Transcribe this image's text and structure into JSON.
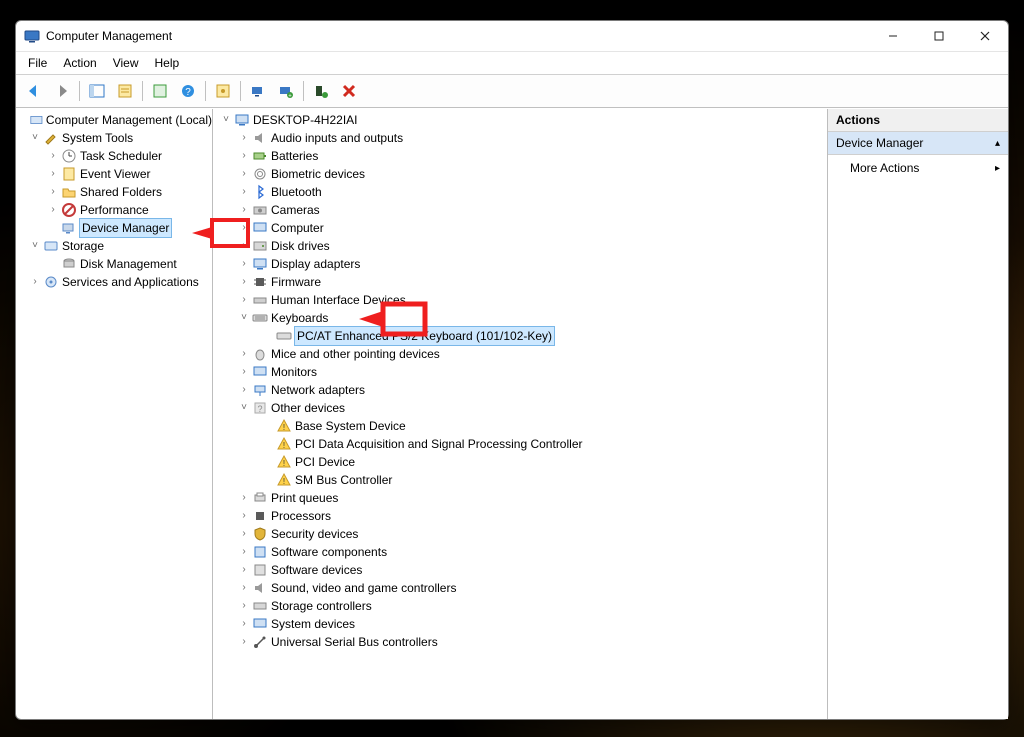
{
  "window": {
    "title": "Computer Management"
  },
  "menu": {
    "file": "File",
    "action": "Action",
    "view": "View",
    "help": "Help"
  },
  "left_tree": {
    "root": "Computer Management (Local)",
    "system_tools": "System Tools",
    "task_scheduler": "Task Scheduler",
    "event_viewer": "Event Viewer",
    "shared_folders": "Shared Folders",
    "performance": "Performance",
    "device_manager": "Device Manager",
    "storage": "Storage",
    "disk_management": "Disk Management",
    "services_apps": "Services and Applications"
  },
  "device_tree": {
    "host": "DESKTOP-4H22IAI",
    "audio": "Audio inputs and outputs",
    "batteries": "Batteries",
    "biometric": "Biometric devices",
    "bluetooth": "Bluetooth",
    "cameras": "Cameras",
    "computer": "Computer",
    "disk": "Disk drives",
    "display": "Display adapters",
    "firmware": "Firmware",
    "hid": "Human Interface Devices",
    "keyboards": "Keyboards",
    "keyboard_child": "PC/AT Enhanced PS/2 Keyboard (101/102-Key)",
    "mice": "Mice and other pointing devices",
    "monitors": "Monitors",
    "network": "Network adapters",
    "other": "Other devices",
    "other_base": "Base System Device",
    "other_pci_daq": "PCI Data Acquisition and Signal Processing Controller",
    "other_pci": "PCI Device",
    "other_smbus": "SM Bus Controller",
    "print": "Print queues",
    "processors": "Processors",
    "security": "Security devices",
    "sw_components": "Software components",
    "sw_devices": "Software devices",
    "sound": "Sound, video and game controllers",
    "storage_ctrl": "Storage controllers",
    "system_devices": "System devices",
    "usb": "Universal Serial Bus controllers"
  },
  "actions": {
    "header": "Actions",
    "section": "Device Manager",
    "more": "More Actions"
  }
}
